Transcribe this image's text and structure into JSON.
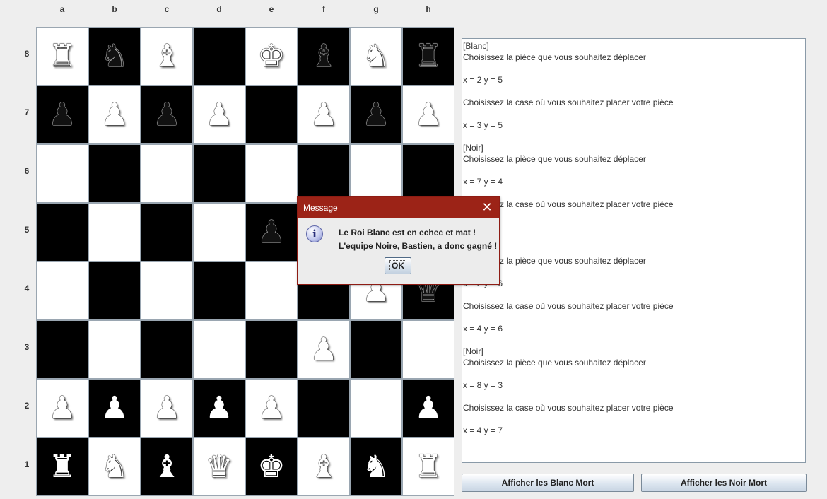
{
  "board": {
    "files": [
      "a",
      "b",
      "c",
      "d",
      "e",
      "f",
      "g",
      "h"
    ],
    "ranks": [
      "8",
      "7",
      "6",
      "5",
      "4",
      "3",
      "2",
      "1"
    ],
    "squares": [
      [
        {
          "piece": "♜",
          "side": "white"
        },
        {
          "piece": "♞",
          "side": "black"
        },
        {
          "piece": "♝",
          "side": "white"
        },
        {
          "piece": "",
          "side": ""
        },
        {
          "piece": "♚",
          "side": "white"
        },
        {
          "piece": "♝",
          "side": "black"
        },
        {
          "piece": "♞",
          "side": "white"
        },
        {
          "piece": "♜",
          "side": "black"
        }
      ],
      [
        {
          "piece": "♟",
          "side": "black"
        },
        {
          "piece": "♟",
          "side": "white"
        },
        {
          "piece": "♟",
          "side": "black"
        },
        {
          "piece": "♟",
          "side": "white"
        },
        {
          "piece": "",
          "side": ""
        },
        {
          "piece": "♟",
          "side": "white"
        },
        {
          "piece": "♟",
          "side": "black"
        },
        {
          "piece": "♟",
          "side": "white"
        }
      ],
      [
        {
          "piece": "",
          "side": ""
        },
        {
          "piece": "",
          "side": ""
        },
        {
          "piece": "",
          "side": ""
        },
        {
          "piece": "",
          "side": ""
        },
        {
          "piece": "",
          "side": ""
        },
        {
          "piece": "",
          "side": ""
        },
        {
          "piece": "",
          "side": ""
        },
        {
          "piece": "",
          "side": ""
        }
      ],
      [
        {
          "piece": "",
          "side": ""
        },
        {
          "piece": "",
          "side": ""
        },
        {
          "piece": "",
          "side": ""
        },
        {
          "piece": "",
          "side": ""
        },
        {
          "piece": "♟",
          "side": "black"
        },
        {
          "piece": "",
          "side": ""
        },
        {
          "piece": "",
          "side": ""
        },
        {
          "piece": "",
          "side": ""
        }
      ],
      [
        {
          "piece": "",
          "side": ""
        },
        {
          "piece": "",
          "side": ""
        },
        {
          "piece": "",
          "side": ""
        },
        {
          "piece": "",
          "side": ""
        },
        {
          "piece": "",
          "side": ""
        },
        {
          "piece": "",
          "side": ""
        },
        {
          "piece": "♟",
          "side": "white"
        },
        {
          "piece": "♛",
          "side": "black"
        }
      ],
      [
        {
          "piece": "",
          "side": ""
        },
        {
          "piece": "",
          "side": ""
        },
        {
          "piece": "",
          "side": ""
        },
        {
          "piece": "",
          "side": ""
        },
        {
          "piece": "",
          "side": ""
        },
        {
          "piece": "♟",
          "side": "white"
        },
        {
          "piece": "",
          "side": ""
        },
        {
          "piece": "",
          "side": ""
        }
      ],
      [
        {
          "piece": "♟",
          "side": "white"
        },
        {
          "piece": "♟",
          "side": "white"
        },
        {
          "piece": "♟",
          "side": "white"
        },
        {
          "piece": "♟",
          "side": "white"
        },
        {
          "piece": "♟",
          "side": "white"
        },
        {
          "piece": "",
          "side": ""
        },
        {
          "piece": "",
          "side": ""
        },
        {
          "piece": "♟",
          "side": "white"
        }
      ],
      [
        {
          "piece": "♜",
          "side": "white"
        },
        {
          "piece": "♞",
          "side": "white"
        },
        {
          "piece": "♝",
          "side": "white"
        },
        {
          "piece": "♛",
          "side": "white"
        },
        {
          "piece": "♚",
          "side": "white"
        },
        {
          "piece": "♝",
          "side": "white"
        },
        {
          "piece": "♞",
          "side": "white"
        },
        {
          "piece": "♜",
          "side": "white"
        }
      ]
    ]
  },
  "log": {
    "lines": [
      "[Blanc]",
      "Choisissez la pièce que vous souhaitez déplacer",
      "",
      "x = 2 y = 5",
      "",
      "Choisissez la case où vous souhaitez placer votre pièce",
      "",
      "x = 3 y = 5",
      "",
      "[Noir]",
      "Choisissez la pièce que vous souhaitez déplacer",
      "",
      "x = 7 y = 4",
      "",
      "Choisissez la case où vous souhaitez placer votre pièce",
      "",
      "",
      "",
      "",
      "Choisissez la pièce que vous souhaitez déplacer",
      "",
      "x = 2 y = 6",
      "",
      "Choisissez la case où vous souhaitez placer votre pièce",
      "",
      "x = 4 y = 6",
      "",
      "[Noir]",
      "Choisissez la pièce que vous souhaitez déplacer",
      "",
      "x = 8 y = 3",
      "",
      "Choisissez la case où vous souhaitez placer votre pièce",
      "",
      "x = 4 y = 7"
    ]
  },
  "buttons": {
    "white_dead": "Afficher les Blanc Mort",
    "black_dead": "Afficher les Noir Mort"
  },
  "dialog": {
    "title": "Message",
    "close_glyph": "✕",
    "icon": "info-icon",
    "icon_glyph": "i",
    "line1": "Le Roi Blanc est en echec et mat !",
    "line2": "L'equipe Noire, Bastien, a donc gagné !",
    "ok_label": "OK"
  },
  "colors": {
    "dialog_title_bar": "#9c2317",
    "dark_square": "#000000",
    "light_square": "#ffffff"
  }
}
